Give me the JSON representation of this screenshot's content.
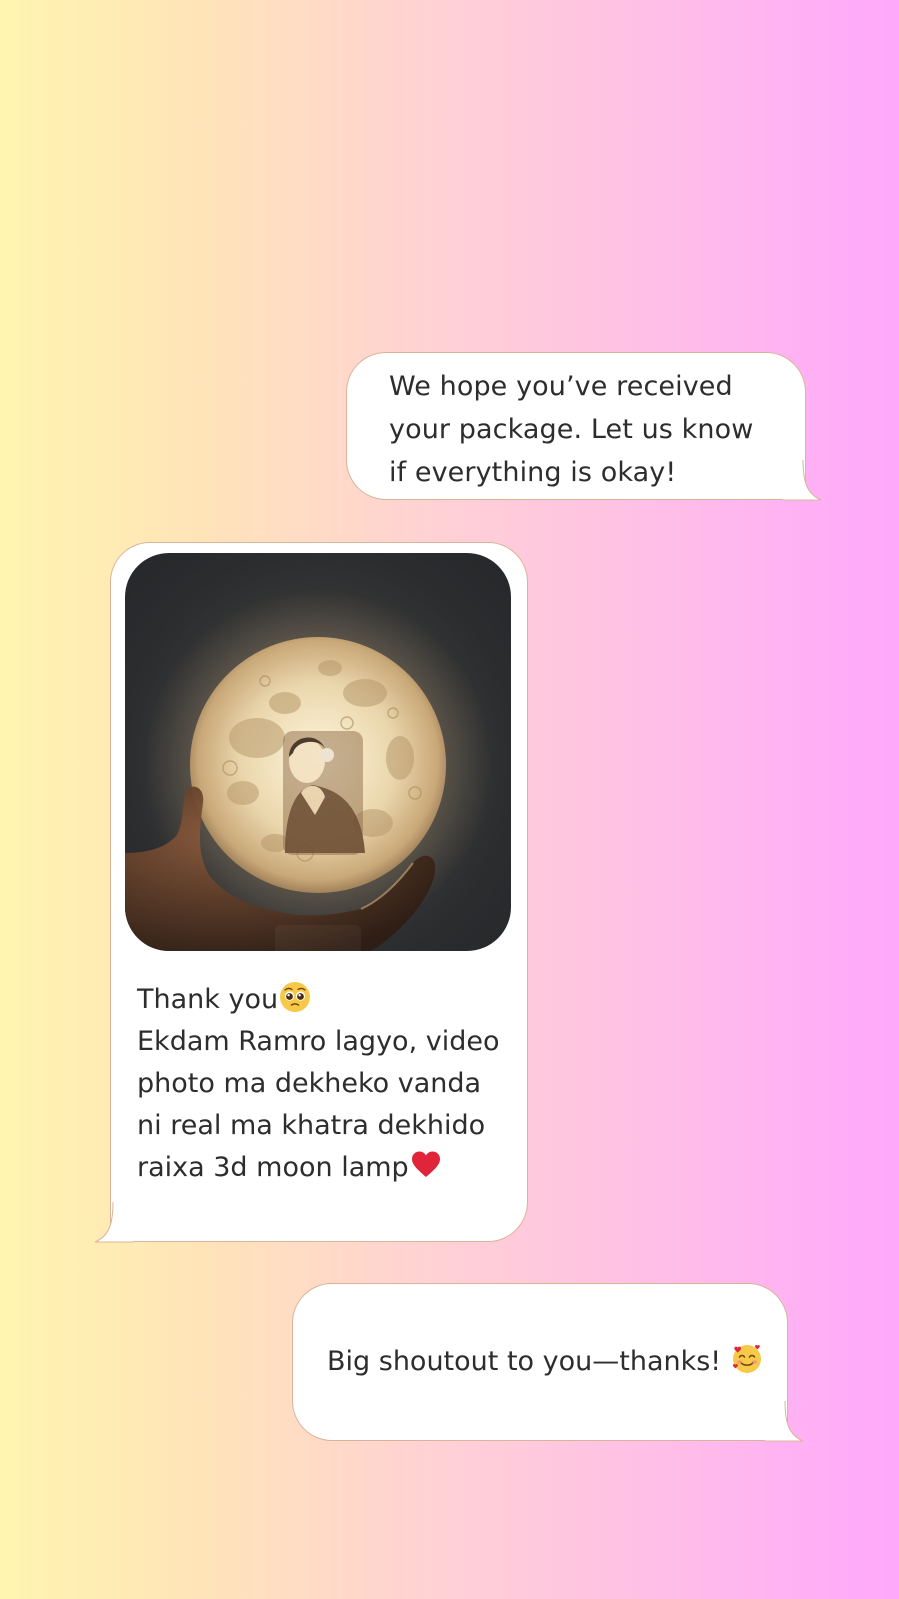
{
  "messages": {
    "outgoing_1": {
      "text": "We hope you’ve received your package. Let us know if everything is okay!"
    },
    "incoming_1": {
      "image": "moon-lamp-photo",
      "line_1": "Thank you",
      "line_1_emoji": "pleading-face-emoji",
      "body": "Ekdam Ramro lagyo, video photo ma dekheko vanda ni real ma khatra dekhido raixa 3d moon lamp",
      "body_emoji": "red-heart-emoji"
    },
    "outgoing_2": {
      "text": "Big shoutout to you—thanks! ",
      "emoji": "smiling-face-with-hearts-emoji"
    }
  },
  "colors": {
    "gradient_left": "#fff5b0",
    "gradient_right": "#ffa8fc",
    "bubble": "#ffffff",
    "bubble_border": "#d9b49a",
    "text": "#2d2d2d"
  }
}
